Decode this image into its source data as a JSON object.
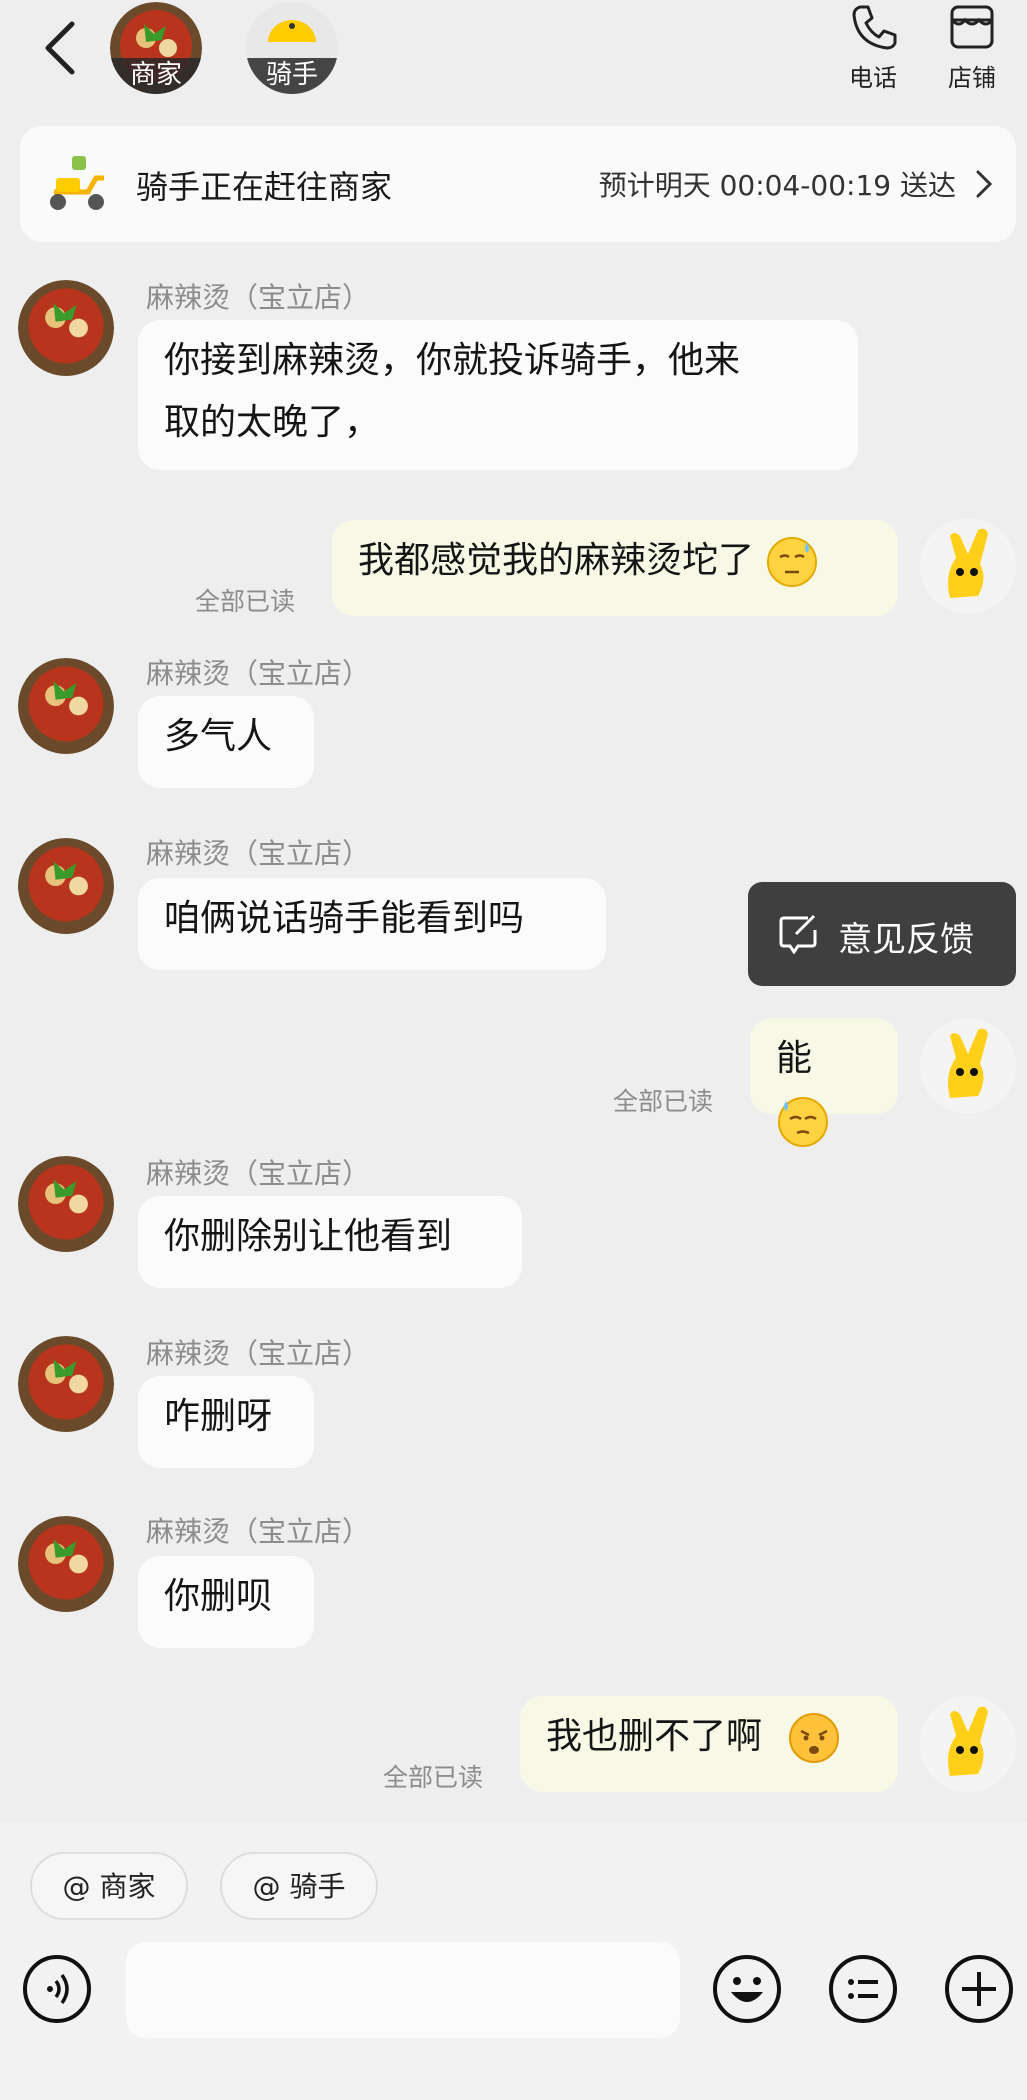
{
  "header": {
    "merchant_label": "商家",
    "rider_label": "骑手",
    "phone_label": "电话",
    "store_label": "店铺"
  },
  "status": {
    "text": "骑手正在赶往商家",
    "eta": "预计明天 00:04-00:19 送达"
  },
  "messages": [
    {
      "from": "merchant",
      "sender": "麻辣烫（宝立店）",
      "lines": [
        "你接到麻辣烫，你就投诉骑手，他来",
        "取的太晚了，"
      ]
    },
    {
      "from": "me",
      "text": "我都感觉我的麻辣烫坨了",
      "read": "全部已读"
    },
    {
      "from": "merchant",
      "sender": "麻辣烫（宝立店）",
      "text": "多气人"
    },
    {
      "from": "merchant",
      "sender": "麻辣烫（宝立店）",
      "text": "咱俩说话骑手能看到吗"
    },
    {
      "from": "me",
      "text": "能",
      "read": "全部已读"
    },
    {
      "from": "merchant",
      "sender": "麻辣烫（宝立店）",
      "text": "你删除别让他看到"
    },
    {
      "from": "merchant",
      "sender": "麻辣烫（宝立店）",
      "text": "咋删呀"
    },
    {
      "from": "merchant",
      "sender": "麻辣烫（宝立店）",
      "text": "你删呗"
    },
    {
      "from": "me",
      "text": "我也删不了啊",
      "read": "全部已读"
    }
  ],
  "feedback_label": "意见反馈",
  "quick_chips": [
    "@ 商家",
    "@ 骑手"
  ],
  "input": {
    "placeholder": ""
  },
  "colors": {
    "accent": "#ffcc00",
    "bubble_out": "#f8f8e6",
    "tooltip": "#3f3f3f"
  }
}
